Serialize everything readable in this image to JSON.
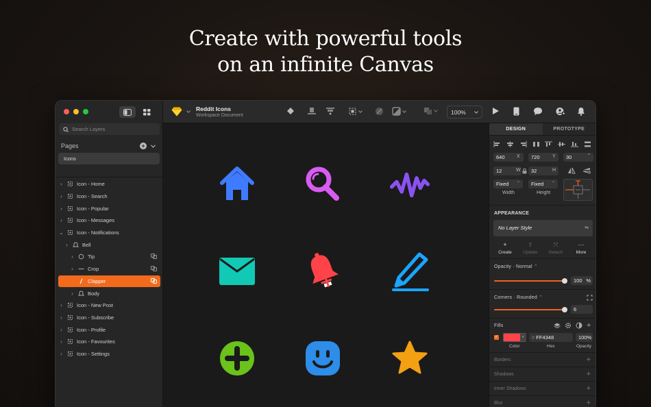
{
  "headline": {
    "line1": "Create with powerful tools",
    "line2": "on an infinite Canvas"
  },
  "sidebar": {
    "search_placeholder": "Search Layers",
    "pages_label": "Pages",
    "pages": [
      "Icons"
    ],
    "layers": [
      {
        "label": "Icon - Home",
        "indent": 0,
        "chev": "›"
      },
      {
        "label": "Icon - Search",
        "indent": 0,
        "chev": "›"
      },
      {
        "label": "Icon - Popular",
        "indent": 0,
        "chev": "›"
      },
      {
        "label": "Icon - Messages",
        "indent": 0,
        "chev": "›"
      },
      {
        "label": "Icon - Notifications",
        "indent": 0,
        "chev": "⌄"
      },
      {
        "label": "Bell",
        "indent": 1,
        "chev": "›"
      },
      {
        "label": "Tip",
        "indent": 2,
        "chev": "›"
      },
      {
        "label": "Crop",
        "indent": 2,
        "chev": "›"
      },
      {
        "label": "Clapper",
        "indent": 2,
        "chev": "",
        "selected": true
      },
      {
        "label": "Body",
        "indent": 2,
        "chev": "›"
      },
      {
        "label": "Icon - New Post",
        "indent": 0,
        "chev": "›"
      },
      {
        "label": "Icon - Subscribe",
        "indent": 0,
        "chev": "›"
      },
      {
        "label": "Icon - Profile",
        "indent": 0,
        "chev": "›"
      },
      {
        "label": "Icon - Favourites",
        "indent": 0,
        "chev": "›"
      },
      {
        "label": "Icon - Settings",
        "indent": 0,
        "chev": "›"
      }
    ]
  },
  "toolbar": {
    "doc_title": "Reddit Icons",
    "doc_subtitle": "Workspace Document",
    "zoom": "100%"
  },
  "inspector": {
    "tab_design": "DESIGN",
    "tab_prototype": "PROTOTYPE",
    "x": "640",
    "x_label": "X",
    "y": "720",
    "y_label": "Y",
    "rotation": "30",
    "rotation_label": "°",
    "w": "12",
    "w_label": "W",
    "h": "32",
    "h_label": "H",
    "width_mode": "Fixed",
    "width_label": "Width",
    "height_mode": "Fixed",
    "height_label": "Height",
    "appearance_title": "APPEARANCE",
    "layer_style": "No Layer Style",
    "style_actions": [
      {
        "label": "Create",
        "enabled": true
      },
      {
        "label": "Update",
        "enabled": false
      },
      {
        "label": "Detach",
        "enabled": false
      },
      {
        "label": "More",
        "enabled": true
      }
    ],
    "opacity_title": "Opacity · Normal",
    "opacity_value": "100",
    "opacity_unit": "%",
    "corners_title": "Corners · Rounded",
    "corners_value": "6",
    "fills_title": "Fills",
    "fill_hex": "FF4348",
    "fill_hex_prefix": "#",
    "fill_opacity": "100%",
    "fill_color_label": "Color",
    "fill_hex_label": "Hex",
    "fill_opacity_label": "Opacity",
    "fill_color": "#ff4348",
    "sections": [
      "Borders",
      "Shadows",
      "Inner Shadows",
      "Blur"
    ]
  },
  "colors": {
    "accent": "#f26b1d",
    "home": "#3f7bff",
    "search": "#d85cf2",
    "popular": "#8a52f2",
    "messages": "#11c9b4",
    "bell": "#ff4348",
    "pencil": "#1aa5ff",
    "add": "#6ac21a",
    "profile": "#2d8de8",
    "star": "#f3a012"
  }
}
